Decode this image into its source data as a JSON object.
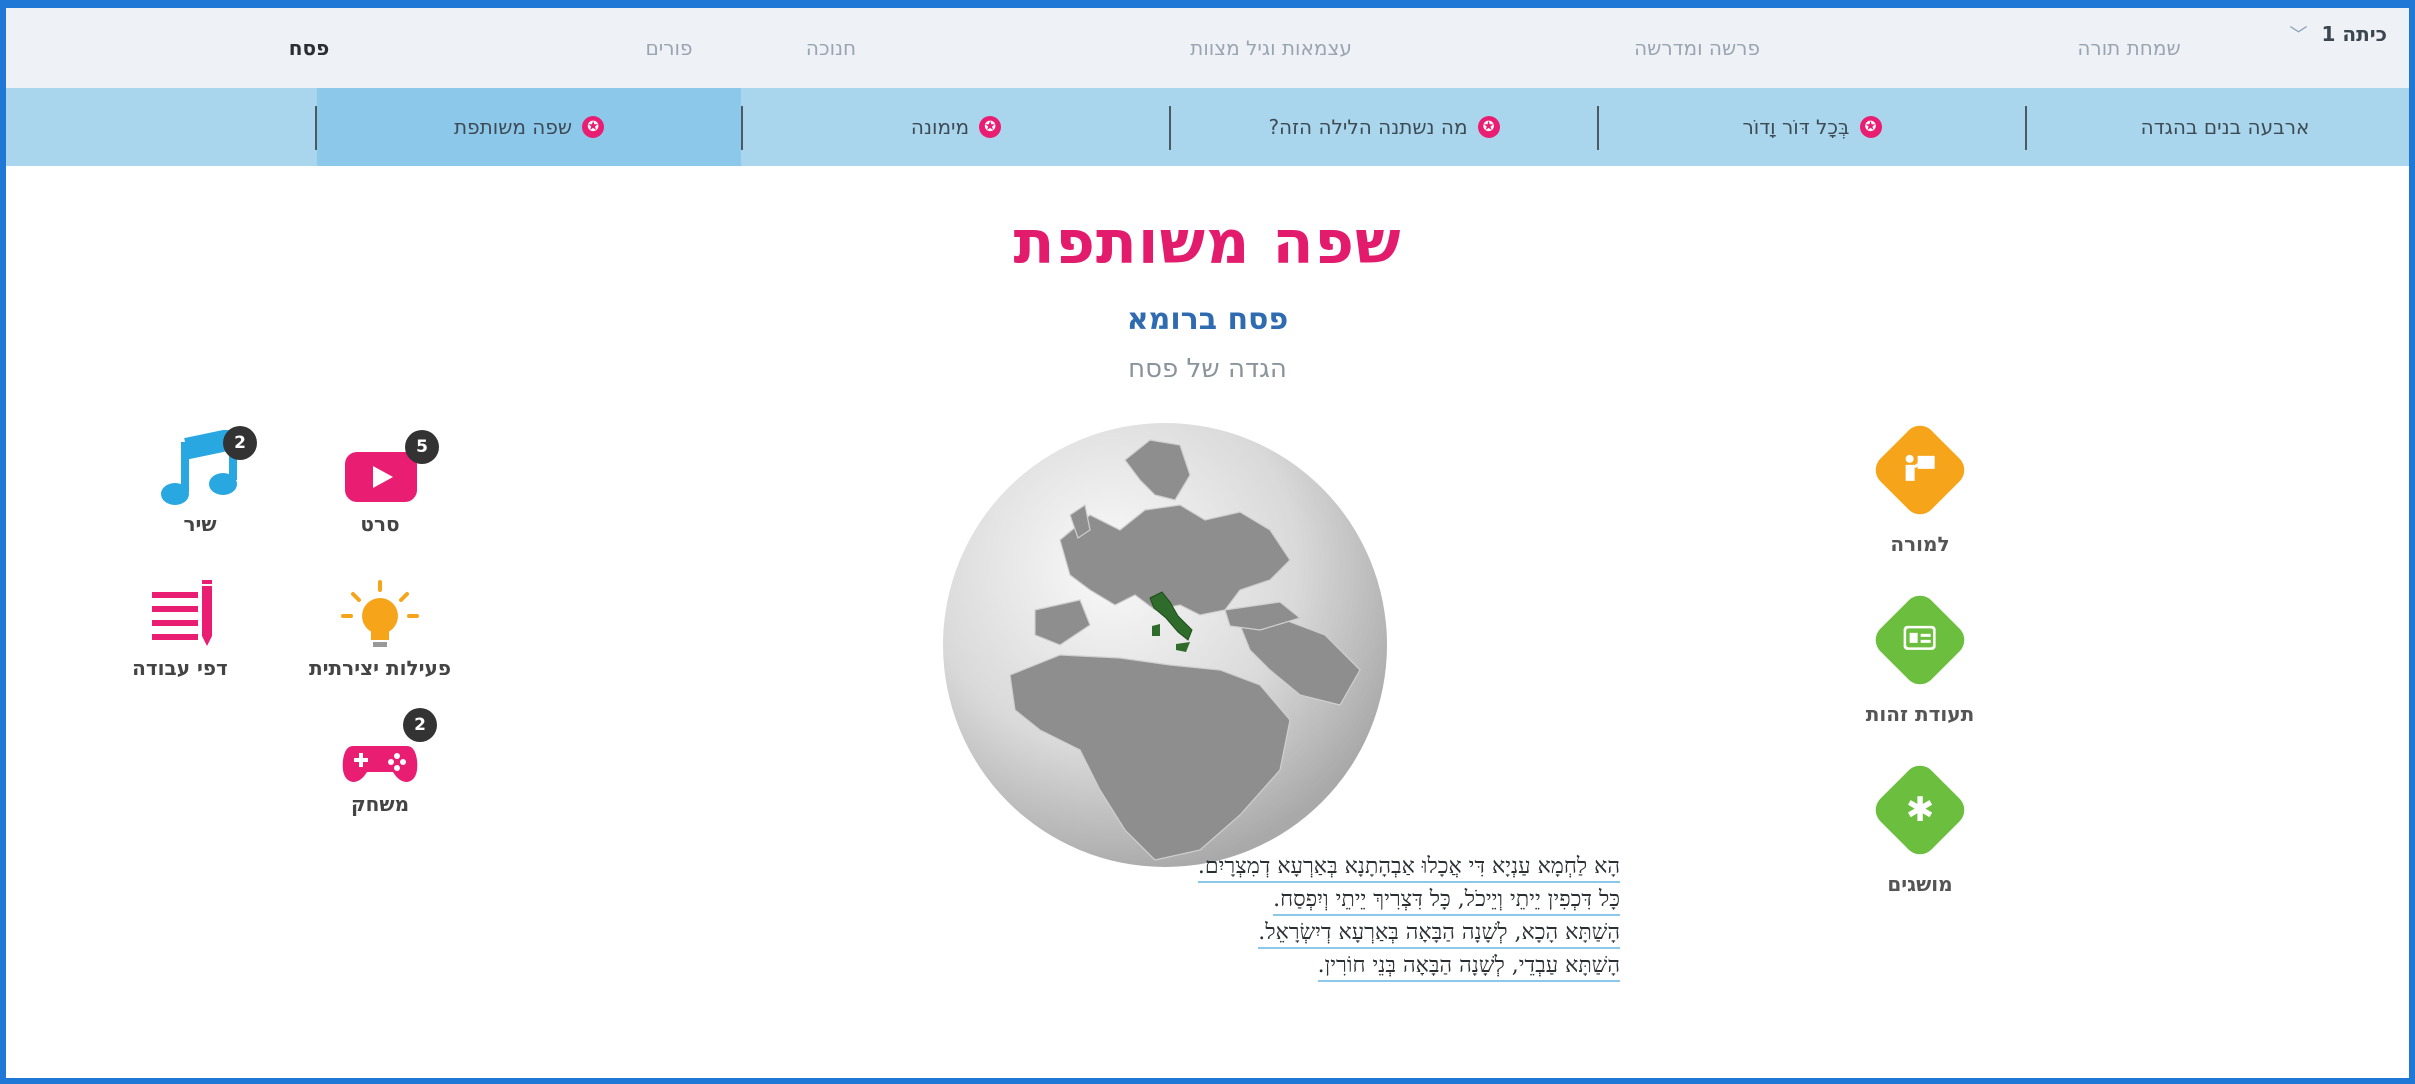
{
  "header": {
    "grade": "כיתה 1",
    "holidays": [
      {
        "label": "שמחת תורה",
        "active": false
      },
      {
        "label": "פרשה ומדרשה",
        "active": false
      },
      {
        "label": "עצמאות וגיל מצוות",
        "active": false
      },
      {
        "label": "חנוכה",
        "active": false
      },
      {
        "label": "פורים",
        "active": false
      },
      {
        "label": "פסח",
        "active": true
      }
    ]
  },
  "subnav": {
    "items": [
      {
        "label": "ארבעה בנים בהגדה",
        "active": false
      },
      {
        "label": "בְּכָל דּוֹר וָדוֹר",
        "active": false
      },
      {
        "label": "מה נשתנה הלילה הזה?",
        "active": false
      },
      {
        "label": "מימונה",
        "active": false
      },
      {
        "label": "שפה משותפת",
        "active": true
      }
    ]
  },
  "main": {
    "title": "שפה משותפת",
    "subtitle": "פסח ברומא",
    "subsubtitle": "הגדה של פסח",
    "text_lines": [
      "הָא לַחְמָא עַנְיָא דִּי אֲכָלוּ אַבְהָתָנָא בְּאַרְעָא דְמִצְרָיִם.",
      "כָּל דִּכְפִין יֵיתֵי וְיֵיכֹל, כָּל דִּצְרִיךְ יֵיתֵי וְיִפְסַח.",
      "הָשַׁתָּא הָכָא, לְשָׁנָה הַבָּאָה בְּאַרְעָא דְיִשְׂרָאֵל.",
      "הָשַׁתָּא עַבְדֵי, לְשָׁנָה הַבָּאָה בְּנֵי חוֹרִין."
    ]
  },
  "resources": [
    {
      "label": "שיר",
      "badge": "2",
      "icon": "music-icon"
    },
    {
      "label": "סרט",
      "badge": "5",
      "icon": "video-icon"
    },
    {
      "label": "דפי עבודה",
      "badge": "",
      "icon": "worksheet-icon"
    },
    {
      "label": "פעילות יצירתית",
      "badge": "",
      "icon": "lightbulb-icon"
    },
    {
      "label": "משחק",
      "badge": "2",
      "icon": "gamepad-icon"
    }
  ],
  "side_menu": [
    {
      "label": "למורה",
      "icon": "teacher-icon",
      "color": "#f6a51b"
    },
    {
      "label": "תעודת זהות",
      "icon": "id-card-icon",
      "color": "#6cbf3e"
    },
    {
      "label": "מושגים",
      "icon": "asterisk-icon",
      "color": "#6cbf3e"
    }
  ],
  "colors": {
    "accent": "#e31b6d",
    "subtitle": "#2e6bb0",
    "subnav_bg": "#a9d6ec",
    "subnav_active": "#8cc8ea",
    "frame": "#1f77d6"
  }
}
